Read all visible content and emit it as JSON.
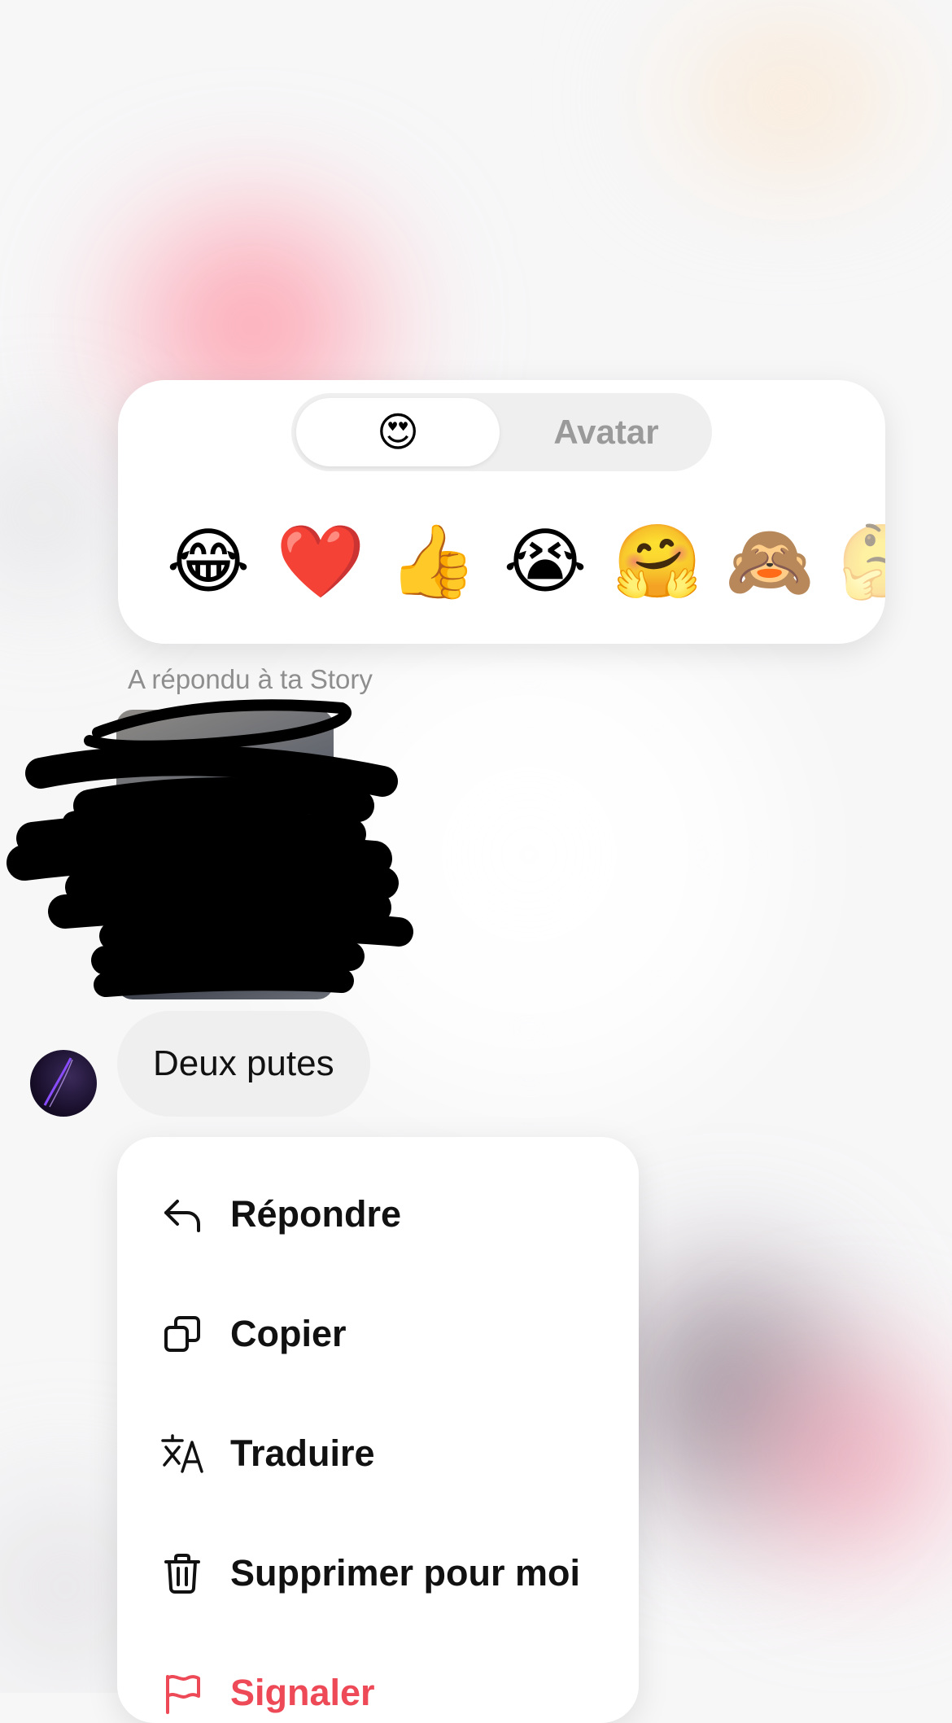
{
  "reaction_picker": {
    "tabs": [
      {
        "label": "😍",
        "selected": true
      },
      {
        "label": "Avatar",
        "selected": false
      }
    ],
    "emojis": [
      "😂",
      "❤️",
      "👍",
      "😭",
      "🤗",
      "🙈",
      "🤔"
    ]
  },
  "story_reply": {
    "label": "A répondu à ta Story"
  },
  "message": {
    "text": "Deux putes"
  },
  "context_menu": {
    "items": [
      {
        "label": "Répondre",
        "icon": "reply-icon"
      },
      {
        "label": "Copier",
        "icon": "copy-icon"
      },
      {
        "label": "Traduire",
        "icon": "translate-icon"
      },
      {
        "label": "Supprimer pour moi",
        "icon": "trash-icon"
      },
      {
        "label": "Signaler",
        "icon": "flag-icon",
        "color": "#ed4956"
      }
    ]
  }
}
